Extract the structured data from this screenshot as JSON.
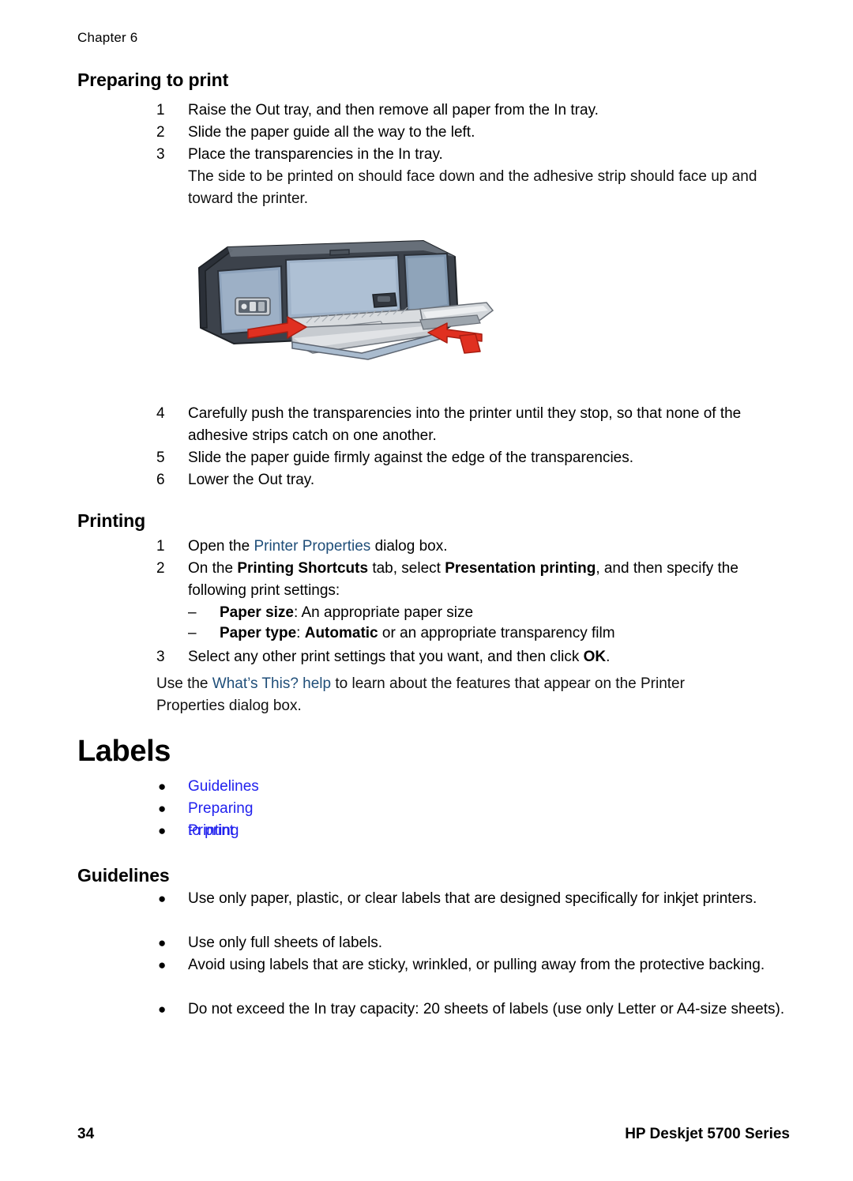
{
  "header": {
    "chapter": "Chapter 6"
  },
  "sections": {
    "preparing": {
      "heading": "Preparing to print",
      "steps": [
        {
          "num": "1",
          "text": "Raise the Out tray, and then remove all paper from the In tray."
        },
        {
          "num": "2",
          "text": "Slide the paper guide all the way to the left."
        },
        {
          "num": "3",
          "text": "Place the transparencies in the In tray."
        }
      ],
      "step3_note": "The side to be printed on should face down and the adhesive strip should face up and toward the printer.",
      "steps_after": [
        {
          "num": "4",
          "text": "Carefully push the transparencies into the printer until they stop, so that none of the adhesive strips catch on one another."
        },
        {
          "num": "5",
          "text": "Slide the paper guide firmly against the edge of the transparencies."
        },
        {
          "num": "6",
          "text": "Lower the Out tray."
        }
      ]
    },
    "printing": {
      "heading": "Printing",
      "step1": {
        "num": "1",
        "prefix": "Open the ",
        "link": "Printer Properties",
        "suffix": " dialog box."
      },
      "step2": {
        "num": "2",
        "part1": "On the ",
        "bold1": "Printing Shortcuts",
        "part2": " tab, select ",
        "bold2": "Presentation printing",
        "part3": ", and then specify the following print settings:"
      },
      "sub_items": [
        {
          "dash": "–",
          "bold": "Paper size",
          "rest": ": An appropriate paper size"
        },
        {
          "dash": "–",
          "bold": "Paper type",
          "boldmid": "Automatic",
          "mid": ": ",
          "rest": " or an appropriate transparency film"
        }
      ],
      "step3": {
        "num": "3",
        "part1": "Select any other print settings that you want, and then click ",
        "bold": "OK",
        "part2": "."
      },
      "closing": {
        "prefix": "Use the ",
        "link": "What’s This? help",
        "suffix": " to learn about the features that appear on the Printer Properties dialog box."
      }
    },
    "labels": {
      "heading": "Labels",
      "toc": [
        {
          "bullet": "●",
          "label": "Guidelines"
        },
        {
          "bullet": "●",
          "label": "Preparing to print"
        },
        {
          "bullet": "●",
          "label": "Printing"
        }
      ]
    },
    "guidelines": {
      "heading": "Guidelines",
      "items": [
        {
          "bullet": "●",
          "text": "Use only paper, plastic, or clear labels that are designed specifically for inkjet printers."
        },
        {
          "bullet": "●",
          "text": "Use only full sheets of labels."
        },
        {
          "bullet": "●",
          "text": "Avoid using labels that are sticky, wrinkled, or pulling away from the protective backing."
        },
        {
          "bullet": "●",
          "text": "Do not exceed the In tray capacity: 20 sheets of labels (use only Letter or A4-size sheets)."
        }
      ]
    }
  },
  "figure": {
    "alt": "HP Deskjet printer with In tray and Out tray open, red arrows indicating paper guide and tray direction"
  },
  "footer": {
    "page_number": "34",
    "product": "HP Deskjet 5700 Series"
  },
  "colors": {
    "link_inline": "#1F4E79",
    "link_toc": "#2222EE",
    "arrow_red": "#E03020",
    "body_dark": "#3A4049",
    "panel_blue": "#8EA3BC"
  }
}
